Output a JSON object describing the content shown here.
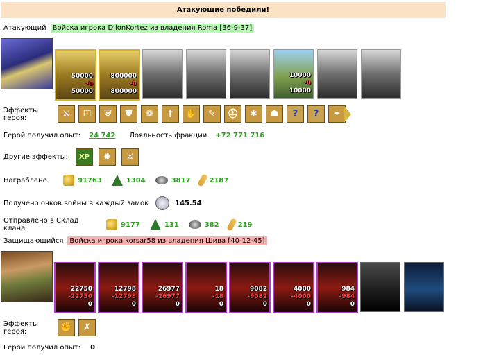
{
  "banner": "Атакующие победили!",
  "attacker": {
    "label": "Атакующий",
    "tag": "Войска игрока DilonKortez из владения Roma [36-9-37]",
    "units": [
      {
        "kind": "gold",
        "c1": "50000",
        "c2": "-0",
        "c3": "50000"
      },
      {
        "kind": "gold",
        "c1": "800000",
        "c2": "-0",
        "c3": "800000"
      },
      {
        "kind": "gray"
      },
      {
        "kind": "gray"
      },
      {
        "kind": "gray"
      },
      {
        "kind": "green",
        "c1": "10000",
        "c2": "-0",
        "c3": "10000"
      },
      {
        "kind": "gray"
      },
      {
        "kind": "gray"
      }
    ],
    "effects_label": "Эффекты героя:",
    "effects_icons": [
      "swords-icon",
      "dice-icon",
      "shield-icon",
      "shield-sword-icon",
      "pouch-icon",
      "sword-icon",
      "handshake-icon",
      "scroll-icon",
      "helmet-icon",
      "web-icon",
      "mask-icon",
      "question-icon",
      "question-icon",
      "wand-icon"
    ],
    "exp_label": "Герой получил опыт:",
    "exp_value": "24 742",
    "loyalty_label": "Лояльность фракции",
    "loyalty_value": "+72 771 716",
    "other_label": "Другие эффекты:",
    "other_icons": [
      "xp-icon",
      "dynamite-icon",
      "sword-icon"
    ],
    "xp_text": "XP",
    "loot_label": "Награблено",
    "loot": {
      "gold": "91763",
      "wood": "1304",
      "ore": "3817",
      "wheat": "2187"
    },
    "war_label": "Получено очков войны в каждый замок",
    "war_value": "145.54",
    "clan_label": "Отправлено в Склад клана",
    "clan": {
      "gold": "9177",
      "wood": "131",
      "ore": "382",
      "wheat": "219"
    }
  },
  "defender": {
    "label": "Защищающийся",
    "tag": "Войска игрока korsar58 из владения Шива [40-12-45]",
    "units": [
      {
        "kind": "red",
        "c1": "22750",
        "c2": "-22750",
        "c3": "0"
      },
      {
        "kind": "red",
        "c1": "12798",
        "c2": "-12798",
        "c3": "0"
      },
      {
        "kind": "red",
        "c1": "26977",
        "c2": "-26977",
        "c3": "0"
      },
      {
        "kind": "red",
        "c1": "18",
        "c2": "-18",
        "c3": "0"
      },
      {
        "kind": "red",
        "c1": "9082",
        "c2": "-9082",
        "c3": "0"
      },
      {
        "kind": "red",
        "c1": "4000",
        "c2": "-4000",
        "c3": "0"
      },
      {
        "kind": "red",
        "c1": "984",
        "c2": "-984",
        "c3": "0"
      },
      {
        "kind": "darkgray"
      },
      {
        "kind": "blue"
      }
    ],
    "effects_label": "Эффекты героя:",
    "effects_icons": [
      "gauntlet-icon",
      "crossed-swords-icon"
    ],
    "exp_label": "Герой получил опыт:",
    "exp_value": "0"
  },
  "question_mark": "?"
}
